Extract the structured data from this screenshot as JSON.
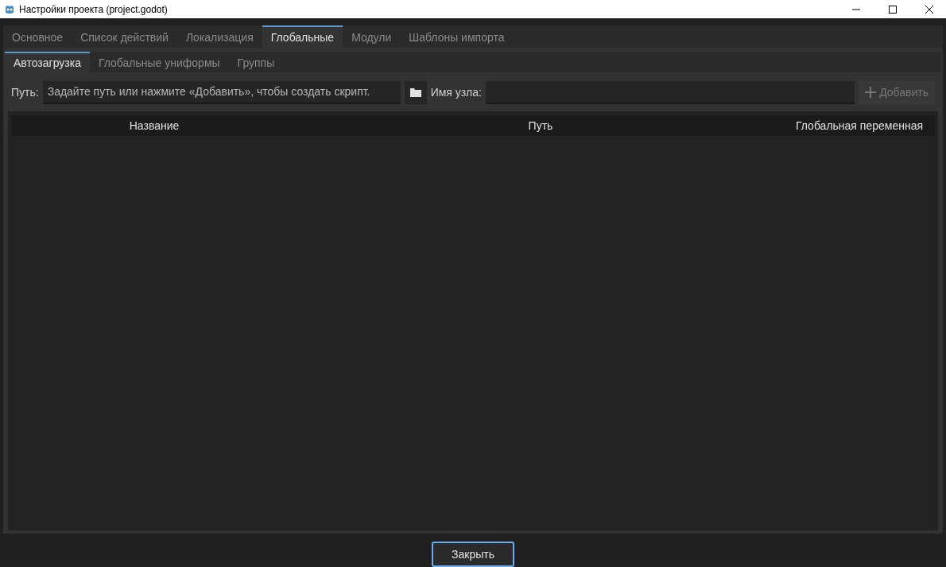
{
  "window": {
    "title": "Настройки проекта (project.godot)"
  },
  "tabs": [
    {
      "label": "Основное",
      "selected": false
    },
    {
      "label": "Список действий",
      "selected": false
    },
    {
      "label": "Локализация",
      "selected": false
    },
    {
      "label": "Глобальные",
      "selected": true
    },
    {
      "label": "Модули",
      "selected": false
    },
    {
      "label": "Шаблоны импорта",
      "selected": false
    }
  ],
  "subtabs": [
    {
      "label": "Автозагрузка",
      "selected": true
    },
    {
      "label": "Глобальные униформы",
      "selected": false
    },
    {
      "label": "Группы",
      "selected": false
    }
  ],
  "path_label": "Путь:",
  "path_field": {
    "placeholder": "Задайте путь или нажмите «Добавить», чтобы создать скрипт."
  },
  "node_name_label": "Имя узла:",
  "add_button": {
    "label": "Добавить",
    "disabled": true
  },
  "table": {
    "columns": [
      "Название",
      "Путь",
      "Глобальная переменная"
    ]
  },
  "close_button": "Закрыть"
}
